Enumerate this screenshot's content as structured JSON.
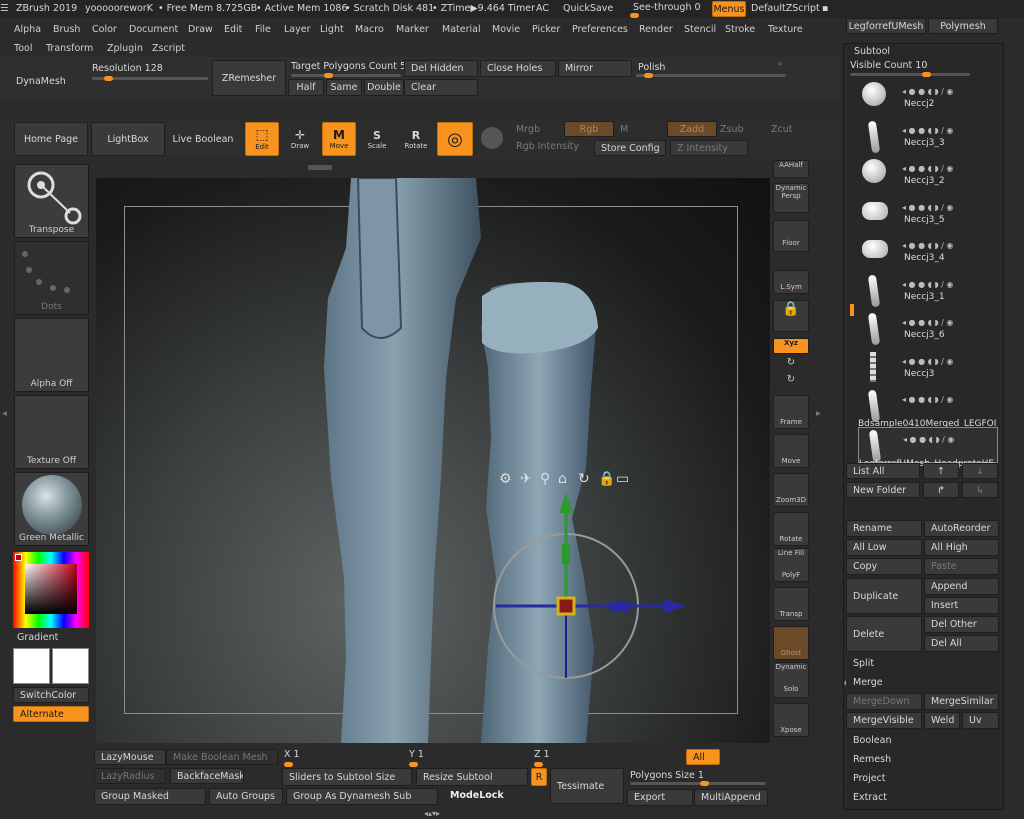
{
  "titlebar": {
    "app": "ZBrush 2019",
    "project": "yoooooreworK",
    "free_mem": "• Free Mem 8.725GB",
    "active_mem": "• Active Mem 1086",
    "scratch": "• Scratch Disk 481",
    "ztime": "• ZTime▶9.464 Timer",
    "ac": "AC",
    "quicksave": "QuickSave",
    "seethrough": "See-through  0",
    "menus": "Menus",
    "defaultzscript": "DefaultZScript",
    "tool_tab_1": "LegforrefUMesh",
    "tool_tab_2": "Polymesh"
  },
  "menu_row1": [
    "Alpha",
    "Brush",
    "Color",
    "Document",
    "Draw",
    "Edit",
    "File",
    "Layer",
    "Light",
    "Macro",
    "Marker",
    "Material",
    "Movie",
    "Picker",
    "Preferences",
    "Render",
    "Stencil",
    "Stroke",
    "Texture"
  ],
  "menu_row2": [
    "Tool",
    "Transform",
    "Zplugin",
    "Zscript"
  ],
  "shelf": {
    "dynamesh": "DynaMesh",
    "resolution": "Resolution 128",
    "resolution_value": 0.1,
    "zremesher": "ZRemesher",
    "target_polygons": "Target Polygons Count 5",
    "target_value": 0.3,
    "half": "Half",
    "same": "Same",
    "double": "Double",
    "del_hidden": "Del Hidden",
    "clear": "Clear",
    "close_holes": "Close Holes",
    "mirror": "Mirror",
    "polish": "Polish",
    "polish_value": 0.05
  },
  "toolbar": {
    "home": "Home Page",
    "lightbox": "LightBox",
    "live_boolean": "Live Boolean",
    "edit": "Edit",
    "draw": "Draw",
    "move": "Move",
    "scale": "Scale",
    "rotate": "Rotate",
    "mrgb": "Mrgb",
    "rgb": "Rgb",
    "m": "M",
    "zadd": "Zadd",
    "zsub": "Zsub",
    "zcut": "Zcut",
    "rgb_intensity": "Rgb Intensity",
    "store_config": "Store Config",
    "z_intensity": "Z Intensity"
  },
  "left_tray": {
    "transpose": "Transpose",
    "dots": "Dots",
    "alpha_off": "Alpha Off",
    "texture_off": "Texture Off",
    "material": "Green Metallic",
    "gradient": "Gradient",
    "switchcolor": "SwitchColor",
    "alternate": "Alternate"
  },
  "right_shelf": [
    "AAHalf",
    "Dynamic",
    "Persp",
    "Floor",
    "L.Sym",
    "Lock",
    "Xyz",
    "Frame",
    "Move",
    "Zoom3D",
    "Rotate",
    "Line Fill",
    "PolyF",
    "Transp",
    "Ghost",
    "Dynamic",
    "Solo",
    "Xpose"
  ],
  "subtool": {
    "title": "Subtool",
    "visible_count": "Visible Count 10",
    "visible_value": 0.6,
    "items": [
      "Neccj2",
      "Neccj3_3",
      "Neccj3_2",
      "Neccj3_5",
      "Neccj3_4",
      "Neccj3_1",
      "Neccj3_6",
      "Neccj3",
      "Bdsample0410Merged_LEGFOI",
      "LegforrefUMesh_HeadprotoHE"
    ],
    "list_all": "List All",
    "new_folder": "New Folder",
    "rename": "Rename",
    "autoreorder": "AutoReorder",
    "all_low": "All Low",
    "all_high": "All High",
    "copy": "Copy",
    "paste": "Paste",
    "duplicate": "Duplicate",
    "append": "Append",
    "insert": "Insert",
    "delete": "Delete",
    "del_other": "Del Other",
    "del_all": "Del All",
    "split": "Split",
    "merge": "Merge",
    "merge_down": "MergeDown",
    "merge_similar": "MergeSimilar",
    "merge_visible": "MergeVisible",
    "weld": "Weld",
    "uv": "Uv",
    "boolean": "Boolean",
    "remesh": "Remesh",
    "project": "Project",
    "extract": "Extract"
  },
  "bottom": {
    "lazymouse": "LazyMouse",
    "make_boolean": "Make Boolean Mesh",
    "x": "X 1",
    "y": "Y 1",
    "z": "Z 1",
    "all": "All",
    "lazyradius": "LazyRadius",
    "backfacemask": "BackfaceMask",
    "sliders_to_subtool": "Sliders to Subtool Size",
    "resize_subtool": "Resize Subtool",
    "r": "R",
    "tessimate": "Tessimate",
    "polygons_size": "Polygons Size 1",
    "group_masked": "Group Masked",
    "auto_groups": "Auto Groups",
    "group_dynamesh": "Group As Dynamesh Sub",
    "modelock": "ModeLock",
    "export": "Export",
    "multiappend": "MultiAppend"
  },
  "colors": {
    "accent": "#f7931e",
    "bg": "#2b2b2b",
    "panel": "#3a3a3a"
  }
}
